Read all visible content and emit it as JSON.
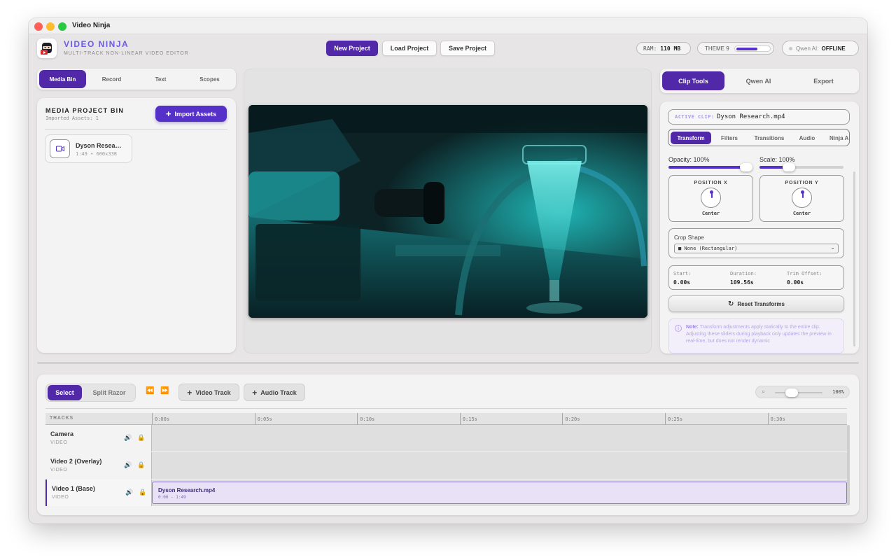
{
  "window": {
    "title": "Video Ninja"
  },
  "header": {
    "app_name": "VIDEO NINJA",
    "app_subtitle": "MULTI-TRACK NON-LINEAR VIDEO EDITOR",
    "buttons": {
      "new_project": "New Project",
      "load_project": "Load Project",
      "save_project": "Save Project"
    },
    "ram_label": "RAM:",
    "ram_value": "110 MB",
    "theme_label": "THEME 9",
    "theme_level": 0.62,
    "qwen_label": "Qwen AI:",
    "qwen_status": "OFFLINE",
    "accent_color": "#5028a8"
  },
  "left_panel": {
    "tabs": [
      "Media Bin",
      "Record",
      "Text",
      "Scopes"
    ],
    "active_tab": "Media Bin",
    "bin_title": "MEDIA PROJECT BIN",
    "imported_assets": "Imported Assets: 1",
    "import_button": "Import Assets",
    "assets": [
      {
        "name": "Dyson Resea…",
        "meta": "1:49 • 600x338",
        "icon": "video-camera-icon"
      }
    ]
  },
  "right_panel": {
    "tabs": [
      "Clip Tools",
      "Qwen AI",
      "Export"
    ],
    "active_tab": "Clip Tools",
    "active_clip_label": "ACTIVE CLIP:",
    "active_clip_value": "Dyson Research.mp4",
    "sub_tabs": [
      "Transform",
      "Filters",
      "Transitions",
      "Audio",
      "Ninja A"
    ],
    "active_sub_tab": "Transform",
    "opacity_label": "Opacity: 100%",
    "opacity_value": 1.0,
    "scale_label": "Scale: 100%",
    "scale_value": 0.35,
    "position_x_label": "POSITION X",
    "position_x_value": "Center",
    "position_y_label": "POSITION Y",
    "position_y_value": "Center",
    "crop_label": "Crop Shape",
    "crop_value": "■ None (Rectangular)",
    "timing": {
      "start_label": "Start:",
      "start_value": "0.00s",
      "duration_label": "Duration:",
      "duration_value": "109.56s",
      "trim_label": "Trim Offset:",
      "trim_value": "0.00s"
    },
    "reset_button": "Reset Transforms",
    "note_label": "Note:",
    "note_text": "Transform adjustments apply statically to the entire clip. Adjusting these sliders during playback only updates the preview in real-time, but does not render dynamic"
  },
  "timeline": {
    "mode_buttons": [
      "Select",
      "Split Razor"
    ],
    "active_mode": "Select",
    "add_video_track": "Video Track",
    "add_audio_track": "Audio Track",
    "zoom_value": "100%",
    "zoom_level": 0.22,
    "tracks_header": "TRACKS",
    "ruler": [
      "0:00s",
      "0:05s",
      "0:10s",
      "0:15s",
      "0:20s",
      "0:25s",
      "0:30s"
    ],
    "tracks": [
      {
        "name": "Camera",
        "type": "VIDEO"
      },
      {
        "name": "Video 2 (Overlay)",
        "type": "VIDEO"
      },
      {
        "name": "Video 1 (Base)",
        "type": "VIDEO"
      }
    ],
    "clip": {
      "name": "Dyson Research.mp4",
      "range": "0:00 - 1:49"
    }
  }
}
